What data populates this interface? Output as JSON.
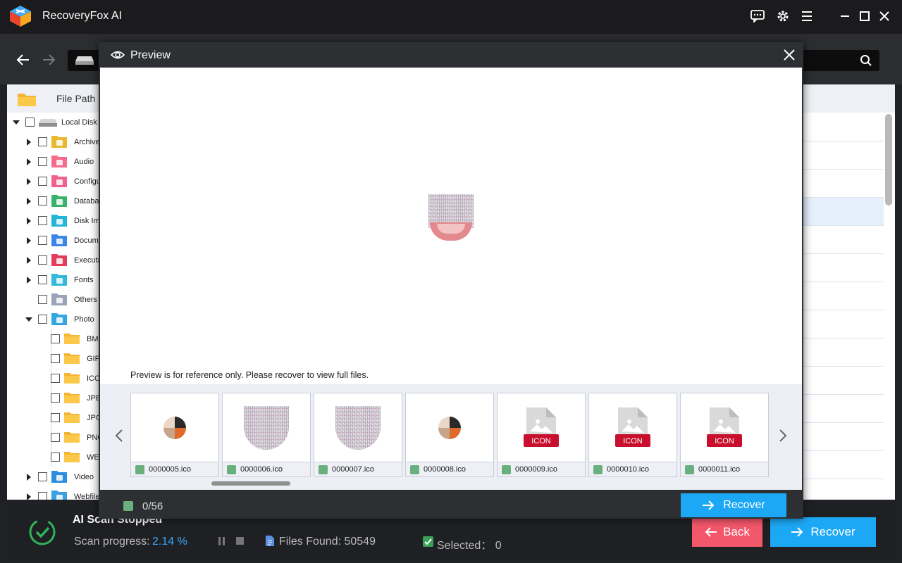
{
  "app": {
    "title": "RecoveryFox AI"
  },
  "left_panel": {
    "header_label": "File Path",
    "tree": [
      {
        "label": "Local Disk (",
        "level": 0,
        "expanded": true,
        "icon": "hard-drive-icon"
      },
      {
        "label": "Archive",
        "level": 1,
        "expanded": false,
        "icon": "archive-folder-icon",
        "color": "#e7b92b"
      },
      {
        "label": "Audio",
        "level": 1,
        "expanded": false,
        "icon": "audio-folder-icon",
        "color": "#f56b8a"
      },
      {
        "label": "Configu",
        "level": 1,
        "expanded": false,
        "icon": "config-folder-icon",
        "color": "#f0628d"
      },
      {
        "label": "Databa",
        "level": 1,
        "expanded": false,
        "icon": "database-folder-icon",
        "color": "#39b36c"
      },
      {
        "label": "Disk Im",
        "level": 1,
        "expanded": false,
        "icon": "disk-image-folder-icon",
        "color": "#22b7d9"
      },
      {
        "label": "Docume",
        "level": 1,
        "expanded": false,
        "icon": "document-folder-icon",
        "color": "#3b87e8"
      },
      {
        "label": "Executa",
        "level": 1,
        "expanded": false,
        "icon": "executable-folder-icon",
        "color": "#e23d5a"
      },
      {
        "label": "Fonts",
        "level": 1,
        "expanded": false,
        "icon": "fonts-folder-icon",
        "color": "#34b9d8"
      },
      {
        "label": "Others",
        "level": 1,
        "expanded": null,
        "icon": "others-folder-icon",
        "color": "#9aa4b8"
      },
      {
        "label": "Photo",
        "level": 1,
        "expanded": true,
        "icon": "photo-folder-icon",
        "color": "#35a7e0"
      },
      {
        "label": "BMP",
        "level": 2,
        "icon": "folder-icon"
      },
      {
        "label": "GIF",
        "level": 2,
        "icon": "folder-icon"
      },
      {
        "label": "ICO",
        "level": 2,
        "icon": "folder-icon"
      },
      {
        "label": "JPE",
        "level": 2,
        "icon": "folder-icon"
      },
      {
        "label": "JPG",
        "level": 2,
        "icon": "folder-icon"
      },
      {
        "label": "PNG",
        "level": 2,
        "icon": "folder-icon"
      },
      {
        "label": "WE",
        "level": 2,
        "icon": "folder-icon"
      },
      {
        "label": "Video",
        "level": 1,
        "expanded": false,
        "icon": "video-folder-icon",
        "color": "#2d8de0"
      },
      {
        "label": "Webfile",
        "level": 1,
        "expanded": false,
        "icon": "webfile-folder-icon",
        "color": "#3aa0e0"
      }
    ]
  },
  "preview": {
    "title": "Preview",
    "note": "Preview is for reference only. Please recover to view full files.",
    "thumbnails": [
      {
        "name": "0000005.ico",
        "kind": "image"
      },
      {
        "name": "0000006.ico",
        "kind": "noise"
      },
      {
        "name": "0000007.ico",
        "kind": "noise"
      },
      {
        "name": "0000008.ico",
        "kind": "image"
      },
      {
        "name": "0000009.ico",
        "kind": "placeholder",
        "badge": "ICON"
      },
      {
        "name": "0000010.ico",
        "kind": "placeholder",
        "badge": "ICON"
      },
      {
        "name": "0000011.ico",
        "kind": "placeholder",
        "badge": "ICON"
      }
    ],
    "count": "0/56",
    "recover_label": "Recover"
  },
  "status": {
    "title": "AI Scan Stopped",
    "progress_label": "Scan progress:",
    "progress_value": "2.14 %",
    "files_found": "Files Found: 50549",
    "selected": "Selected： 0"
  },
  "buttons": {
    "back": "Back",
    "recover": "Recover"
  },
  "colors": {
    "accent": "#1da8f5",
    "back": "#f2576a",
    "success": "#3aa055"
  }
}
